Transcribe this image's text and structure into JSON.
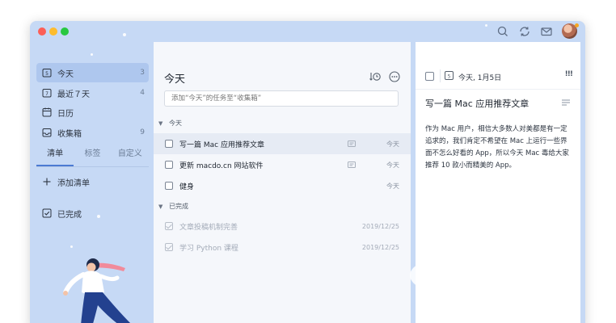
{
  "sidebar": {
    "items": [
      {
        "label": "今天",
        "count": "3",
        "icon": "today-calendar-icon"
      },
      {
        "label": "最近７天",
        "count": "4",
        "icon": "week-calendar-icon"
      },
      {
        "label": "日历",
        "count": "",
        "icon": "calendar-icon"
      },
      {
        "label": "收集箱",
        "count": "9",
        "icon": "inbox-icon"
      }
    ],
    "tabs": [
      "清单",
      "标签",
      "自定义"
    ],
    "add_list": "添加清单",
    "completed": "已完成"
  },
  "list": {
    "title": "今天",
    "search_placeholder": "添加“今天”的任务至“收集箱”",
    "groups": [
      {
        "name": "今天",
        "tasks": [
          {
            "title": "写一篇 Mac 应用推荐文章",
            "date": "今天",
            "has_note": true,
            "done": false
          },
          {
            "title": "更新 macdo.cn 网站软件",
            "date": "今天",
            "has_note": true,
            "done": false
          },
          {
            "title": "健身",
            "date": "今天",
            "has_note": false,
            "done": false
          }
        ]
      },
      {
        "name": "已完成",
        "tasks": [
          {
            "title": "文章投稿机制完善",
            "date": "2019/12/25",
            "has_note": false,
            "done": true
          },
          {
            "title": "学习 Python 课程",
            "date": "2019/12/25",
            "has_note": false,
            "done": true
          }
        ]
      }
    ]
  },
  "detail": {
    "date": "今天, 1月5日",
    "priority": "!!!",
    "title": "写一篇 Mac 应用推荐文章",
    "body": "作为 Mac 用户，相信大多数人对美都是有一定追求的，我们肯定不希望在 Mac 上运行一些界面不怎么好看的 App，所以今天 Mac 毒给大家推荐 10 款小而精美的 App。"
  },
  "colors": {
    "accent": "#4c7bd3",
    "sidebar_bg": "#c6d9f5",
    "selected_item": "#aec7ee"
  }
}
